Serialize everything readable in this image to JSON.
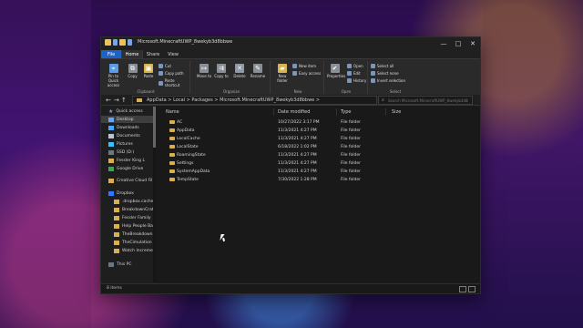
{
  "window": {
    "title": "Microsoft.MinecraftUWP_8wekyb3d8bbwe",
    "controls": [
      "—",
      "□",
      "✕"
    ]
  },
  "ribbon_tabs": {
    "file": "File",
    "home": "Home",
    "share": "Share",
    "view": "View"
  },
  "ribbon": {
    "clipboard": {
      "pin_to_quick_access": "Pin to Quick access",
      "copy": "Copy",
      "paste": "Paste",
      "cut": "Cut",
      "copy_path": "Copy path",
      "paste_shortcut": "Paste shortcut",
      "group_label": "Clipboard"
    },
    "organize": {
      "move_to": "Move to",
      "copy_to": "Copy to",
      "delete": "Delete",
      "rename": "Rename",
      "group_label": "Organize"
    },
    "new": {
      "new_folder": "New folder",
      "new_item": "New item",
      "easy_access": "Easy access",
      "group_label": "New"
    },
    "open": {
      "properties": "Properties",
      "open": "Open",
      "edit": "Edit",
      "history": "History",
      "group_label": "Open"
    },
    "select": {
      "select_all": "Select all",
      "select_none": "Select none",
      "invert_selection": "Invert selection",
      "group_label": "Select"
    }
  },
  "address": {
    "path": "AppData  >  Local  >  Packages  >  Microsoft.MinecraftUWP_8wekyb3d8bbwe  >",
    "search_placeholder": "Search Microsoft.MinecraftUWP_8wekyb3d8bbwe"
  },
  "sidebar": {
    "items": [
      {
        "label": "Quick access",
        "icon": "star-icon"
      },
      {
        "label": "Desktop",
        "icon": "desktop-icon"
      },
      {
        "label": "Downloads",
        "icon": "downloads-icon"
      },
      {
        "label": "Documents",
        "icon": "documents-icon"
      },
      {
        "label": "Pictures",
        "icon": "pictures-icon"
      },
      {
        "label": "SSD (D:)",
        "icon": "drive-icon"
      },
      {
        "label": "Fessler King L",
        "icon": "folder-icon"
      },
      {
        "label": "Google Drive",
        "icon": "google-drive-icon"
      },
      {
        "label": "Creative Cloud Fil",
        "icon": "folder-icon"
      },
      {
        "label": "Dropbox",
        "icon": "dropbox-icon"
      },
      {
        "label": ".dropbox.cache",
        "icon": "folder-icon"
      },
      {
        "label": "BreakdownCraft",
        "icon": "folder-icon"
      },
      {
        "label": "Fessler Family",
        "icon": "folder-icon"
      },
      {
        "label": "Help People Bac",
        "icon": "folder-icon"
      },
      {
        "label": "TheBreakdown",
        "icon": "folder-icon"
      },
      {
        "label": "TheCimulation",
        "icon": "folder-icon"
      },
      {
        "label": "Watch Incremen",
        "icon": "folder-icon"
      },
      {
        "label": "This PC",
        "icon": "pc-icon"
      }
    ]
  },
  "table": {
    "headers": {
      "name": "Name",
      "date_modified": "Date modified",
      "type": "Type",
      "size": "Size"
    },
    "rows": [
      {
        "name": "AC",
        "date": "10/27/2022 3:17 PM",
        "type": "File folder"
      },
      {
        "name": "AppData",
        "date": "11/3/2021 4:27 PM",
        "type": "File folder"
      },
      {
        "name": "LocalCache",
        "date": "11/3/2021 4:27 PM",
        "type": "File folder"
      },
      {
        "name": "LocalState",
        "date": "6/18/2022 1:02 PM",
        "type": "File folder"
      },
      {
        "name": "RoamingState",
        "date": "11/3/2021 4:27 PM",
        "type": "File folder"
      },
      {
        "name": "Settings",
        "date": "11/3/2021 4:27 PM",
        "type": "File folder"
      },
      {
        "name": "SystemAppData",
        "date": "11/3/2021 4:27 PM",
        "type": "File folder"
      },
      {
        "name": "TempState",
        "date": "7/30/2022 1:28 PM",
        "type": "File folder"
      }
    ]
  },
  "status": {
    "items_count": "8 items"
  }
}
